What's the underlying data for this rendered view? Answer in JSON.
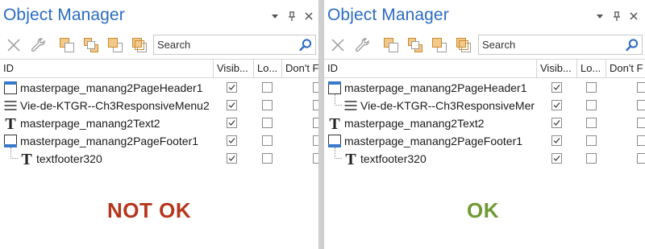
{
  "colors": {
    "title": "#2b6cc4",
    "not_ok": "#b5361c",
    "ok": "#6e9a33",
    "accent_icon": "#e8a33a"
  },
  "panels": [
    {
      "title": "Object Manager",
      "titlebar_buttons": [
        "dropdown-icon",
        "pin-icon",
        "close-icon"
      ],
      "toolbar_icons": [
        "close-x-icon",
        "wrench-icon",
        "layer-back-icon",
        "layer-arrange-icon",
        "layer-front-icon",
        "layer-stack-icon"
      ],
      "search": {
        "placeholder": "Search",
        "value": ""
      },
      "columns": [
        "ID",
        "Visib...",
        "Lo...",
        "Don't F"
      ],
      "rows": [
        {
          "name": "masterpage_manang2PageHeader1",
          "icon": "page-header-icon",
          "indent": 0,
          "visible": true
        },
        {
          "name": "Vie-de-KTGR--Ch3ResponsiveMenu2",
          "icon": "menu-icon",
          "indent": 0,
          "visible": true
        },
        {
          "name": "masterpage_manang2Text2",
          "icon": "text-icon",
          "indent": 0,
          "visible": true
        },
        {
          "name": "masterpage_manang2PageFooter1",
          "icon": "page-footer-icon",
          "indent": 0,
          "visible": true
        },
        {
          "name": "textfooter320",
          "icon": "text-icon",
          "indent": 1,
          "visible": true
        }
      ],
      "status": "NOT OK"
    },
    {
      "title": "Object Manager",
      "titlebar_buttons": [
        "dropdown-icon",
        "pin-icon",
        "close-icon"
      ],
      "toolbar_icons": [
        "close-x-icon",
        "wrench-icon",
        "layer-back-icon",
        "layer-arrange-icon",
        "layer-front-icon",
        "layer-stack-icon"
      ],
      "search": {
        "placeholder": "Search",
        "value": ""
      },
      "columns": [
        "ID",
        "Visib...",
        "Lo...",
        "Don't F"
      ],
      "rows": [
        {
          "name": "masterpage_manang2PageHeader1",
          "icon": "page-header-icon",
          "indent": 0,
          "visible": true
        },
        {
          "name": "Vie-de-KTGR--Ch3ResponsiveMer",
          "icon": "menu-icon",
          "indent": 1,
          "visible": true
        },
        {
          "name": "masterpage_manang2Text2",
          "icon": "text-icon",
          "indent": 0,
          "visible": true
        },
        {
          "name": "masterpage_manang2PageFooter1",
          "icon": "page-footer-icon",
          "indent": 0,
          "visible": true
        },
        {
          "name": "textfooter320",
          "icon": "text-icon",
          "indent": 1,
          "visible": true
        }
      ],
      "status": "OK"
    }
  ]
}
